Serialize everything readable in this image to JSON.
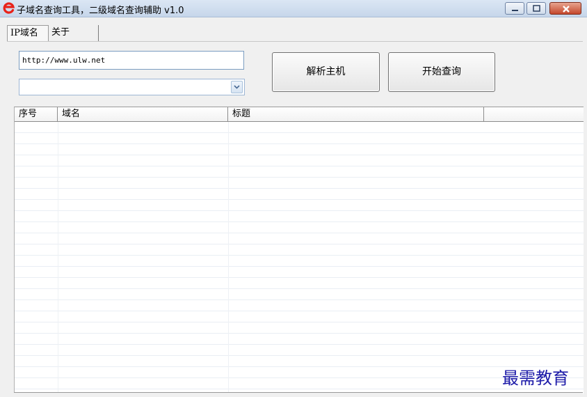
{
  "window": {
    "title": "子域名查询工具，二级域名查询辅助 v1.0",
    "icon": "e-logo-icon"
  },
  "tabs": [
    {
      "label": "IP域名",
      "active": true
    },
    {
      "label": "关于",
      "active": false
    }
  ],
  "form": {
    "url_value": "http://www.ulw.net",
    "combo_value": ""
  },
  "buttons": {
    "parse_label": "解析主机",
    "query_label": "开始查询"
  },
  "table": {
    "columns": [
      "序号",
      "域名",
      "标题",
      ""
    ],
    "rows": []
  },
  "watermark": "最需教育",
  "colors": {
    "logo_red": "#e8221a",
    "watermark_blue": "#1c1aa8"
  }
}
